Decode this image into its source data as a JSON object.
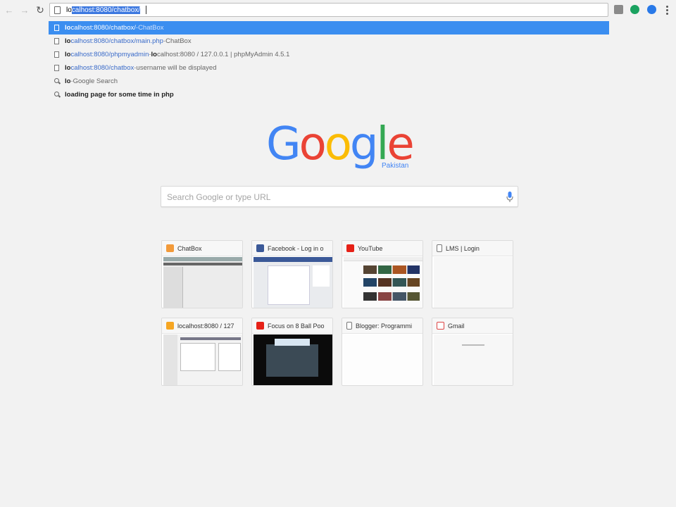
{
  "toolbar": {
    "omnibox_typed": "lo",
    "omnibox_completion": "calhost:8080/chatbox/"
  },
  "suggestions": [
    {
      "match": "lo",
      "rest": "calhost:8080/chatbox/",
      "sep": " - ",
      "desc": "ChatBox",
      "type": "url",
      "selected": true
    },
    {
      "match": "lo",
      "rest": "calhost:8080/chatbox/main.php",
      "sep": " - ",
      "desc": "ChatBox",
      "type": "url",
      "selected": false
    },
    {
      "match": "lo",
      "rest": "calhost:8080/phpmyadmin",
      "sep": " - ",
      "desc_match": "lo",
      "desc": "calhost:8080 / 127.0.0.1 | phpMyAdmin 4.5.1",
      "type": "url",
      "selected": false
    },
    {
      "match": "lo",
      "rest": "calhost:8080/chatbox",
      "sep": " - ",
      "desc": "username will be displayed",
      "type": "url",
      "selected": false
    },
    {
      "match": "lo",
      "rest": "",
      "sep": " - ",
      "desc": "Google Search",
      "type": "search",
      "selected": false
    },
    {
      "match": "lo",
      "rest": "ading page for some time in php",
      "sep": "",
      "desc": "",
      "type": "search",
      "selected": false
    }
  ],
  "logo": {
    "letters": [
      "G",
      "o",
      "o",
      "g",
      "l",
      "e"
    ],
    "colors": [
      "#4285f4",
      "#ea4335",
      "#fbbc05",
      "#4285f4",
      "#34a853",
      "#ea4335"
    ],
    "region": "Pakistan"
  },
  "search": {
    "placeholder": "Search Google or type URL"
  },
  "tiles": [
    {
      "title": "ChatBox",
      "icon": "chatbox-icon"
    },
    {
      "title": "Facebook - Log in o",
      "icon": "facebook-icon"
    },
    {
      "title": "YouTube",
      "icon": "youtube-icon"
    },
    {
      "title": "LMS | Login",
      "icon": "page-icon"
    },
    {
      "title": "localhost:8080 / 127",
      "icon": "phpmyadmin-icon"
    },
    {
      "title": "Focus on 8 Ball Poo",
      "icon": "youtube-icon"
    },
    {
      "title": "Blogger: Programmi",
      "icon": "page-icon"
    },
    {
      "title": "Gmail",
      "icon": "gmail-icon"
    }
  ],
  "colors": {
    "selection": "#3b8ef0",
    "background": "#f2f2f2"
  }
}
